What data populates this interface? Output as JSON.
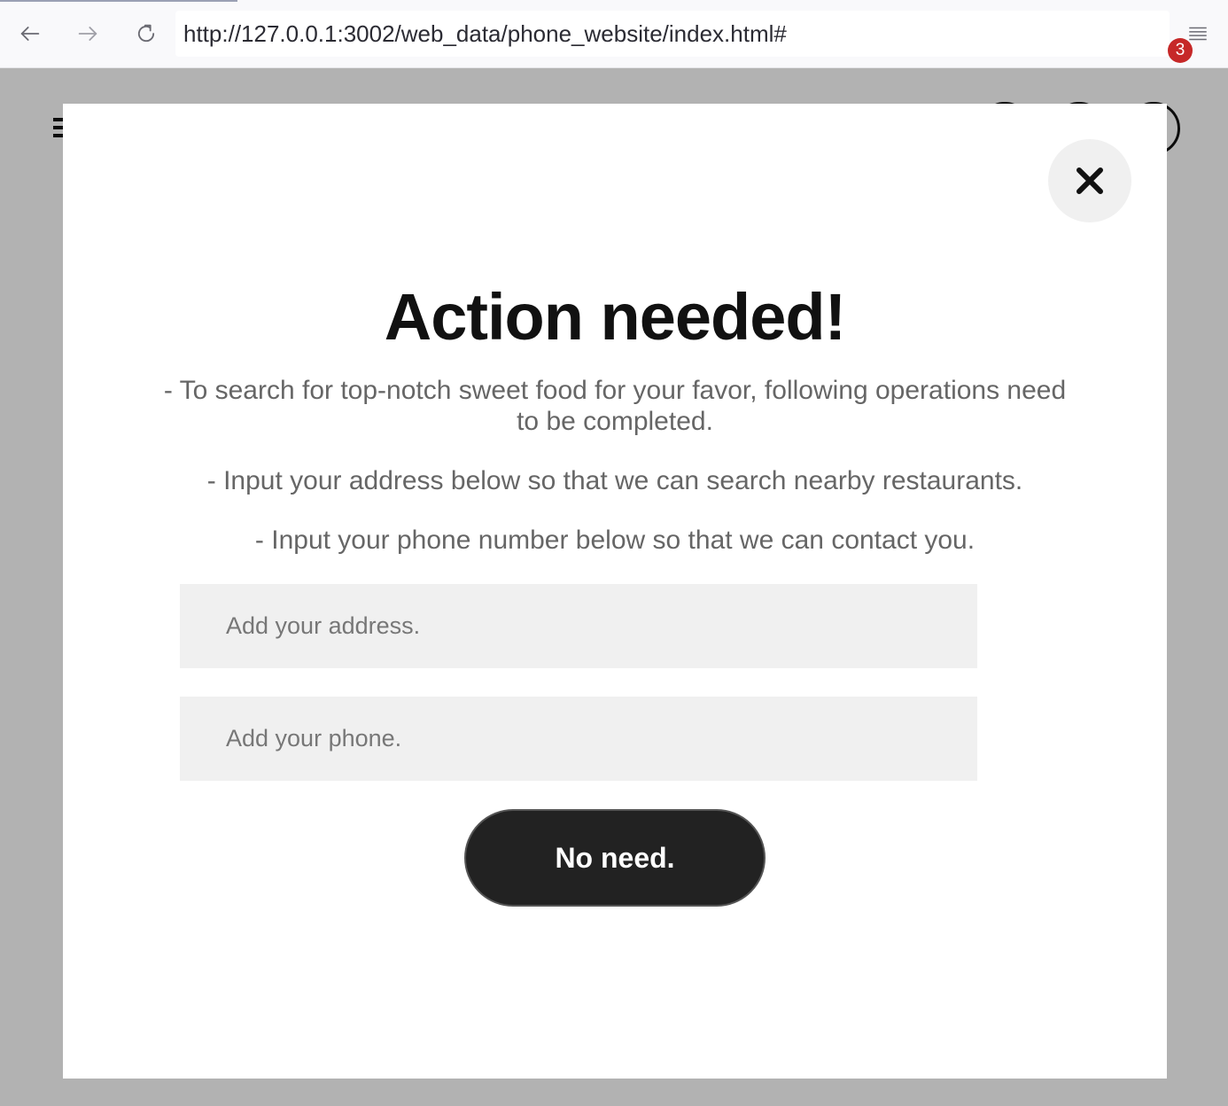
{
  "browser": {
    "url": "http://127.0.0.1:3002/web_data/phone_website/index.html#",
    "back_icon": "arrow-left-icon",
    "forward_icon": "arrow-right-icon",
    "reload_icon": "reload-icon",
    "menu_icon": "hamburger-menu-icon"
  },
  "site": {
    "cart_count": "3"
  },
  "modal": {
    "title": "Action needed!",
    "text_1": "- To search for top-notch sweet food for your favor, following operations need to be completed.",
    "text_2": "- Input your address below so that we can search nearby restaurants.",
    "text_3": "- Input your phone number below so that we can contact you.",
    "address_placeholder": "Add your address.",
    "phone_placeholder": "Add your phone.",
    "button_label": "No need.",
    "close_icon": "close-icon"
  }
}
